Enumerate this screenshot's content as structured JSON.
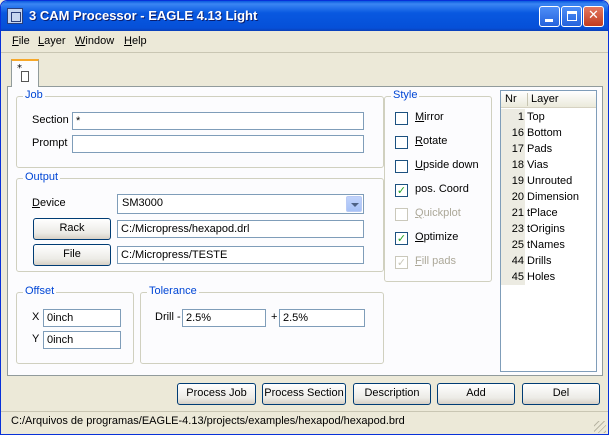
{
  "window": {
    "title": "3 CAM Processor - EAGLE 4.13 Light",
    "minimize_glyph": "",
    "close_glyph": "✕"
  },
  "menu": [
    {
      "underline": "F",
      "rest": "ile"
    },
    {
      "underline": "L",
      "rest": "ayer"
    },
    {
      "underline": "W",
      "rest": "indow"
    },
    {
      "underline": "H",
      "rest": "elp"
    }
  ],
  "tab": {
    "label": "*"
  },
  "job": {
    "title": "Job",
    "section_label": "Section",
    "section_value": "*",
    "prompt_label": "Prompt",
    "prompt_value": ""
  },
  "output": {
    "title": "Output",
    "device_label": "Device",
    "device_value": "SM3000",
    "rack_button": "Rack",
    "rack_value": "C:/Micropress/hexapod.drl",
    "file_button": "File",
    "file_value": "C:/Micropress/TESTE"
  },
  "offset": {
    "title": "Offset",
    "x_label": "X",
    "x_value": "0inch",
    "y_label": "Y",
    "y_value": "0inch"
  },
  "tolerance": {
    "title": "Tolerance",
    "drill_label": "Drill -",
    "drill_minus": "2.5%",
    "plus_label": "+",
    "drill_plus": "2.5%"
  },
  "style": {
    "title": "Style",
    "check_mark": "✓",
    "options": [
      {
        "label_u": "M",
        "label_rest": "irror",
        "checked": false,
        "enabled": true
      },
      {
        "label_u": "R",
        "label_rest": "otate",
        "checked": false,
        "enabled": true
      },
      {
        "label_u": "U",
        "label_rest": "pside down",
        "checked": false,
        "enabled": true
      },
      {
        "label_u": "",
        "label_rest": "pos. Coord",
        "checked": true,
        "enabled": true
      },
      {
        "label_u": "Q",
        "label_rest": "uickplot",
        "checked": false,
        "enabled": false
      },
      {
        "label_u": "O",
        "label_rest": "ptimize",
        "checked": true,
        "enabled": true
      },
      {
        "label_u": "F",
        "label_rest": "ill pads",
        "checked": true,
        "enabled": false
      }
    ]
  },
  "layers": {
    "header_nr": "Nr",
    "header_layer": "Layer",
    "rows": [
      {
        "nr": "1",
        "name": "Top"
      },
      {
        "nr": "16",
        "name": "Bottom"
      },
      {
        "nr": "17",
        "name": "Pads"
      },
      {
        "nr": "18",
        "name": "Vias"
      },
      {
        "nr": "19",
        "name": "Unrouted"
      },
      {
        "nr": "20",
        "name": "Dimension"
      },
      {
        "nr": "21",
        "name": "tPlace"
      },
      {
        "nr": "23",
        "name": "tOrigins"
      },
      {
        "nr": "25",
        "name": "tNames"
      },
      {
        "nr": "44",
        "name": "Drills"
      },
      {
        "nr": "45",
        "name": "Holes"
      }
    ]
  },
  "buttons": {
    "process_job": "Process Job",
    "process_section": "Process Section",
    "description": "Description",
    "add": "Add",
    "del": "Del"
  },
  "status": {
    "path": "C:/Arquivos de programas/EAGLE-4.13/projects/examples/hexapod/hexapod.brd"
  }
}
